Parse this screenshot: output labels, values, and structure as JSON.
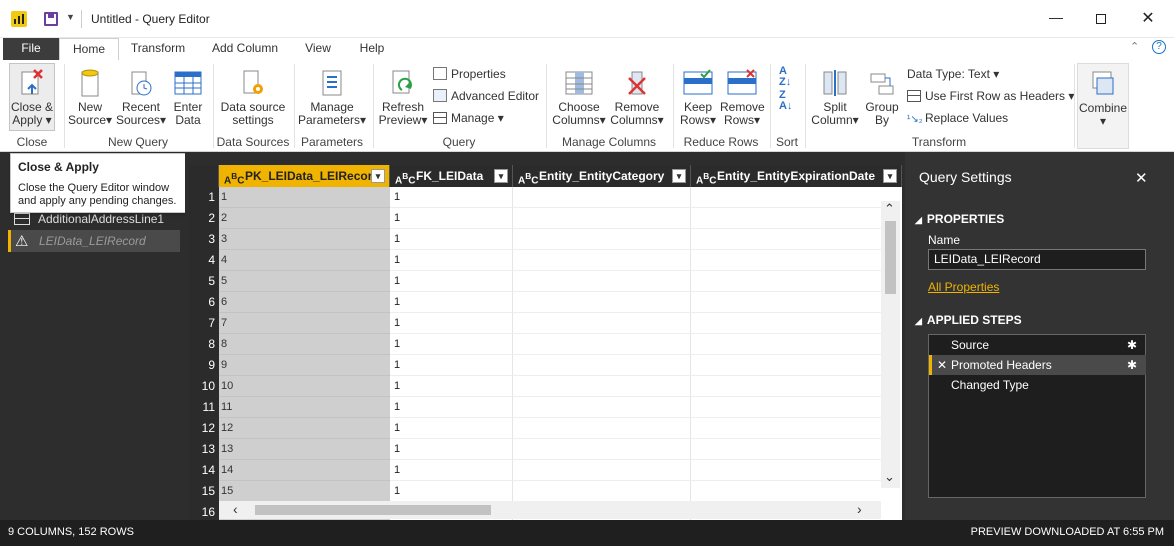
{
  "window": {
    "title": "Untitled - Query Editor"
  },
  "tabs": [
    "File",
    "Home",
    "Transform",
    "Add Column",
    "View",
    "Help"
  ],
  "ribbon": {
    "close_apply": [
      "Close &",
      "Apply"
    ],
    "new_source": [
      "New",
      "Source"
    ],
    "recent_sources": [
      "Recent",
      "Sources"
    ],
    "enter_data": [
      "Enter",
      "Data"
    ],
    "data_source_settings": [
      "Data source",
      "settings"
    ],
    "manage_parameters": [
      "Manage",
      "Parameters"
    ],
    "refresh_preview": [
      "Refresh",
      "Preview"
    ],
    "properties": "Properties",
    "advanced_editor": "Advanced Editor",
    "manage": "Manage",
    "choose_columns": [
      "Choose",
      "Columns"
    ],
    "remove_columns": [
      "Remove",
      "Columns"
    ],
    "keep_rows": [
      "Keep",
      "Rows"
    ],
    "remove_rows": [
      "Remove",
      "Rows"
    ],
    "split_column": [
      "Split",
      "Column"
    ],
    "group_by": [
      "Group",
      "By"
    ],
    "data_type": "Data Type: Text",
    "use_first_row": "Use First Row as Headers",
    "replace_values": "Replace Values",
    "combine": "Combine",
    "groups": [
      "Close",
      "New Query",
      "Data Sources",
      "Parameters",
      "Query",
      "Manage Columns",
      "Reduce Rows",
      "Sort",
      "Transform"
    ]
  },
  "tooltip": {
    "title": "Close & Apply",
    "body": [
      "Close the Query Editor window",
      "and apply any pending changes."
    ]
  },
  "queries": {
    "items": [
      "AdditionalAddressLine1",
      "LEIData_LEIRecord"
    ]
  },
  "grid": {
    "columns": [
      "PK_LEIData_LEIRecord",
      "FK_LEIData",
      "Entity_EntityCategory",
      "Entity_EntityExpirationDate"
    ],
    "row_numbers": [
      "1",
      "2",
      "3",
      "4",
      "5",
      "6",
      "7",
      "8",
      "9",
      "10",
      "11",
      "12",
      "13",
      "14",
      "15",
      "16"
    ],
    "col1": [
      "1",
      "2",
      "3",
      "4",
      "5",
      "6",
      "7",
      "8",
      "9",
      "10",
      "11",
      "12",
      "13",
      "14",
      "15",
      ""
    ],
    "col2": [
      "1",
      "1",
      "1",
      "1",
      "1",
      "1",
      "1",
      "1",
      "1",
      "1",
      "1",
      "1",
      "1",
      "1",
      "1",
      ""
    ]
  },
  "settings": {
    "title": "Query Settings",
    "properties_label": "PROPERTIES",
    "name_label": "Name",
    "name_value": "LEIData_LEIRecord",
    "all_properties": "All Properties",
    "applied_steps_label": "APPLIED STEPS",
    "steps": [
      "Source",
      "Promoted Headers",
      "Changed Type"
    ]
  },
  "status": {
    "left": "9 COLUMNS, 152 ROWS",
    "right": "PREVIEW DOWNLOADED AT 6:55 PM"
  },
  "colors": {
    "accent": "#f0b400",
    "dark_pane": "#2d2d2d",
    "file_tab": "#3c3c3c"
  }
}
